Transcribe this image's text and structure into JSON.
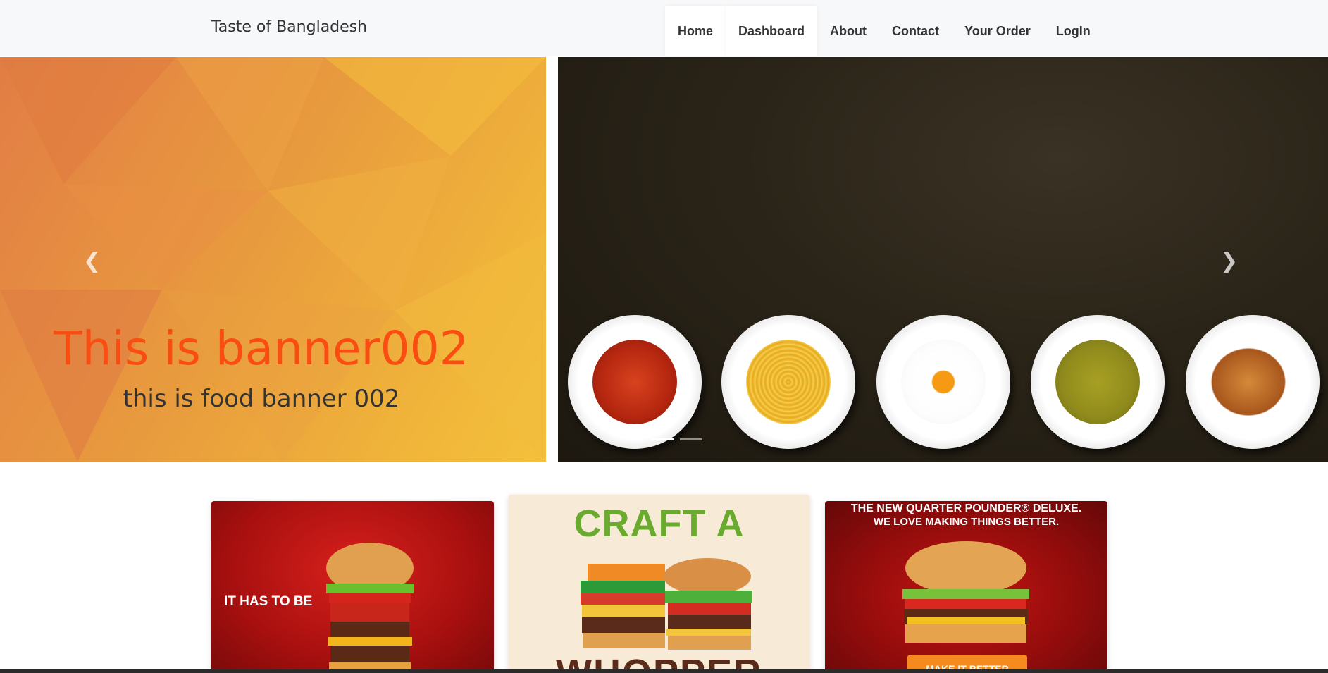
{
  "navbar": {
    "brand": "Taste of Bangladesh",
    "items": [
      {
        "label": "Home",
        "active": true
      },
      {
        "label": "Dashboard",
        "active": true
      },
      {
        "label": "About",
        "active": false
      },
      {
        "label": "Contact",
        "active": false
      },
      {
        "label": "Your Order",
        "active": false
      },
      {
        "label": "LogIn",
        "active": false
      }
    ]
  },
  "carousel": {
    "title": "This is banner002",
    "subtitle": "this is food banner 002",
    "prev_icon": "chevron-left-icon",
    "next_icon": "chevron-right-icon",
    "indicators": 2
  },
  "cards": [
    {
      "text": "IT HAS TO BE"
    },
    {
      "headline_top": "CRAFT A",
      "headline_bottom": "WHOPPER"
    },
    {
      "line1": "THE NEW QUARTER POUNDER® DELUXE.",
      "line2": "WE LOVE MAKING THINGS BETTER.",
      "button": "MAKE IT BETTER"
    }
  ],
  "colors": {
    "banner_title": "#fa4d12",
    "nav_bg": "#f7f8f9",
    "craft_green": "#6aaa2e"
  }
}
